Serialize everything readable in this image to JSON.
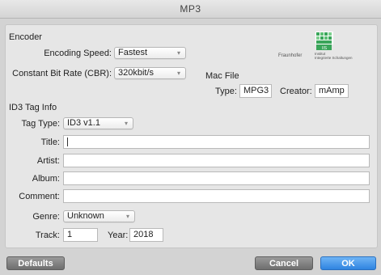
{
  "window": {
    "title": "MP3"
  },
  "encoder": {
    "section_label": "Encoder",
    "speed_label": "Encoding Speed:",
    "speed_value": "Fastest",
    "bitrate_label": "Constant Bit Rate (CBR):",
    "bitrate_value": "320kbit/s"
  },
  "mac_file": {
    "section_label": "Mac File",
    "type_label": "Type:",
    "type_value": "MPG3",
    "creator_label": "Creator:",
    "creator_value": "mAmp"
  },
  "logo": {
    "name": "Fraunhofer",
    "sub_line1": "Institut",
    "sub_line2": "Integrierte Schaltungen",
    "badge": "IIS"
  },
  "id3": {
    "section_label": "ID3 Tag Info",
    "tag_type_label": "Tag Type:",
    "tag_type_value": "ID3 v1.1",
    "title_label": "Title:",
    "title_value": "",
    "artist_label": "Artist:",
    "artist_value": "",
    "album_label": "Album:",
    "album_value": "",
    "comment_label": "Comment:",
    "comment_value": "",
    "genre_label": "Genre:",
    "genre_value": "Unknown",
    "track_label": "Track:",
    "track_value": "1",
    "year_label": "Year:",
    "year_value": "2018"
  },
  "buttons": {
    "defaults": "Defaults",
    "cancel": "Cancel",
    "ok": "OK"
  },
  "colors": {
    "ok_button": "#2f84e0",
    "logo_green": "#3aa55a"
  }
}
